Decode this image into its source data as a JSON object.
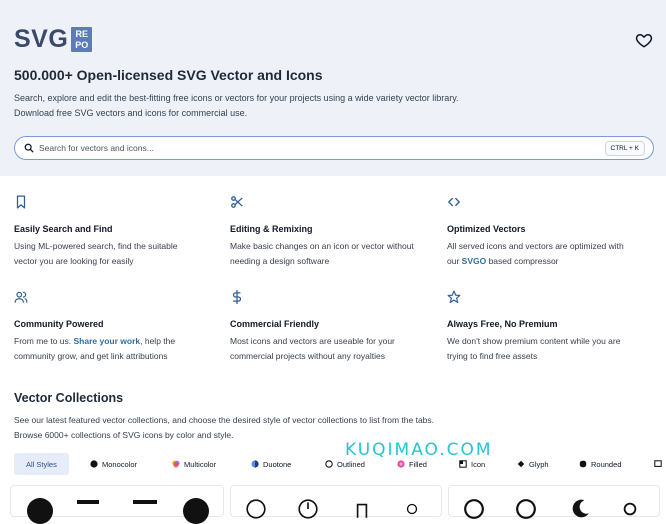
{
  "header": {
    "logo_text": "SVG",
    "logo_badge_line1": "RE",
    "logo_badge_line2": "PO"
  },
  "hero": {
    "title": "500.000+ Open-licensed SVG Vector and Icons",
    "desc_line1": "Search, explore and edit the best-fitting free icons or vectors for your projects using a wide variety vector library.",
    "desc_line2": "Download free SVG vectors and icons for commercial use."
  },
  "search": {
    "placeholder": "Search for vectors and icons...",
    "shortcut": "CTRL + K"
  },
  "features": [
    {
      "icon": "bookmark-icon",
      "title": "Easily Search and Find",
      "line1": "Using ML-powered search, find the suitable",
      "line2": "vector you are looking for easily"
    },
    {
      "icon": "scissors-icon",
      "title": "Editing & Remixing",
      "line1": "Make basic changes on an icon or vector without",
      "line2": "needing a design software"
    },
    {
      "icon": "code-icon",
      "title": "Optimized Vectors",
      "line1": "All served icons and vectors are optimized with",
      "line2_pre": "our ",
      "line2_link": "SVGO",
      "line2_post": " based compressor"
    },
    {
      "icon": "users-icon",
      "title": "Community Powered",
      "line1_pre": "From me to us. ",
      "line1_link": "Share your work",
      "line1_post": ", help the",
      "line2": "community grow, and get link attributions"
    },
    {
      "icon": "dollar-icon",
      "title": "Commercial Friendly",
      "line1": "Most icons and vectors are useable for your",
      "line2": "commercial projects without any royalties"
    },
    {
      "icon": "star-icon",
      "title": "Always Free, No Premium",
      "line1": "We don't show premium content while you are",
      "line2": "trying to find free assets"
    }
  ],
  "collections": {
    "title": "Vector Collections",
    "desc_line1": "See our latest featured vector collections, and choose the desired style of vector collections to list from the tabs.",
    "desc_line2": "Browse 6000+ collections of SVG icons by color and style.",
    "tabs": [
      "All Styles",
      "Monocolor",
      "Multicolor",
      "Duotone",
      "Outlined",
      "Filled",
      "Icon",
      "Glyph",
      "Rounded"
    ]
  },
  "watermark": "KUQIMAO.COM",
  "colors": {
    "hero_bg": "#eef2f8",
    "logo": "#3b4a6b",
    "badge": "#5c7bb8",
    "link": "#2f6f9f",
    "active_tab": "#e6edf8"
  }
}
